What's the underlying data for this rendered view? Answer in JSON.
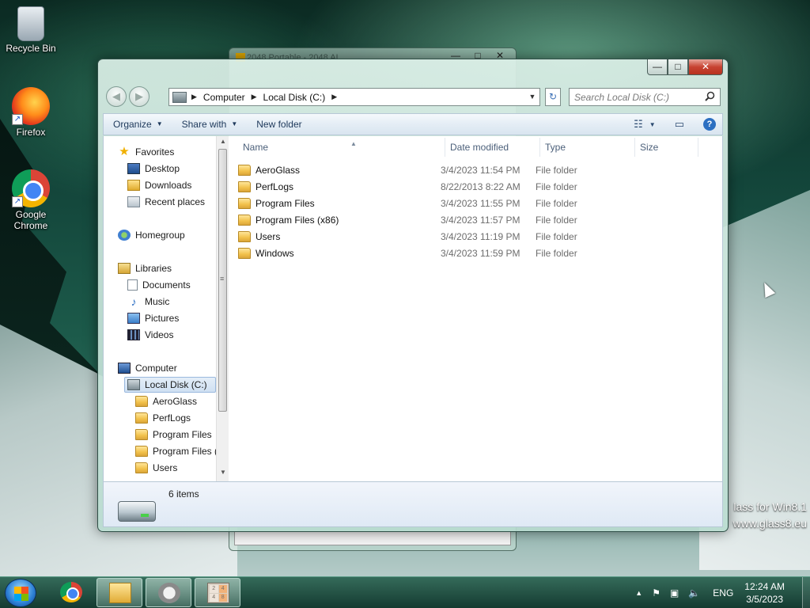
{
  "desktop": {
    "icons": [
      {
        "label": "Recycle Bin",
        "icon": "recycle-bin-icon"
      },
      {
        "label": "Firefox",
        "icon": "firefox-icon"
      },
      {
        "label": "Google Chrome",
        "icon": "chrome-icon"
      }
    ],
    "watermark_line1": "lass for Win8.1",
    "watermark_line2": "www.glass8.eu"
  },
  "background_window": {
    "title": "2048 Portable - 2048 AI",
    "buttons": [
      "—",
      "□",
      "✕"
    ]
  },
  "explorer": {
    "caption_buttons": {
      "minimize": "—",
      "maximize": "□",
      "close": "✕"
    },
    "nav": {
      "back": "◀",
      "forward": "▶"
    },
    "address": {
      "crumbs": [
        "Computer",
        "Local Disk (C:)"
      ],
      "separator": "▶",
      "dropdown": "▼"
    },
    "refresh_glyph": "↻",
    "search": {
      "placeholder": "Search Local Disk (C:)",
      "value": "",
      "icon": "search-icon"
    },
    "toolbar": {
      "organize": "Organize",
      "share_with": "Share with",
      "new_folder": "New folder",
      "dd": "▼",
      "view_glyph": "☷",
      "view_dd": "▼",
      "preview_glyph": "▭",
      "help_glyph": "?"
    },
    "nav_pane": {
      "favorites": {
        "label": "Favorites",
        "items": [
          "Desktop",
          "Downloads",
          "Recent places"
        ]
      },
      "homegroup": "Homegroup",
      "libraries": {
        "label": "Libraries",
        "items": [
          "Documents",
          "Music",
          "Pictures",
          "Videos"
        ]
      },
      "computer": {
        "label": "Computer",
        "selected": "Local Disk (C:)",
        "folders": [
          "AeroGlass",
          "PerfLogs",
          "Program Files",
          "Program Files (",
          "Users"
        ]
      },
      "scroll_up": "▲",
      "scroll_down": "▼",
      "scroll_grip": "≡"
    },
    "columns": {
      "name": "Name",
      "date": "Date modified",
      "type": "Type",
      "size": "Size",
      "sort_glyph": "▲"
    },
    "files": [
      {
        "name": "AeroGlass",
        "date": "3/4/2023 11:54 PM",
        "type": "File folder"
      },
      {
        "name": "PerfLogs",
        "date": "8/22/2013 8:22 AM",
        "type": "File folder"
      },
      {
        "name": "Program Files",
        "date": "3/4/2023 11:55 PM",
        "type": "File folder"
      },
      {
        "name": "Program Files (x86)",
        "date": "3/4/2023 11:57 PM",
        "type": "File folder"
      },
      {
        "name": "Users",
        "date": "3/4/2023 11:19 PM",
        "type": "File folder"
      },
      {
        "name": "Windows",
        "date": "3/4/2023 11:59 PM",
        "type": "File folder"
      }
    ],
    "status": {
      "item_count": "6 items"
    }
  },
  "taskbar": {
    "apps": [
      "Google Chrome",
      "Windows Explorer",
      "App",
      "2048 Portable"
    ],
    "tile_2048": [
      "2",
      "4",
      "4",
      "8"
    ],
    "tray": {
      "show_hidden": "▲",
      "action_center": "⚑",
      "network": "▣",
      "volume": "🔈",
      "language": "ENG",
      "time": "12:24 AM",
      "date": "3/5/2023"
    }
  }
}
